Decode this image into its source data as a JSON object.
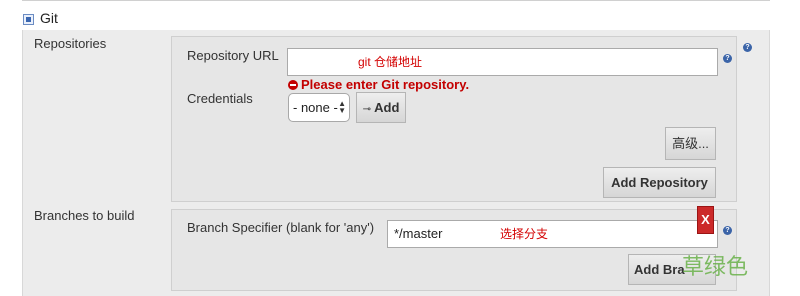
{
  "scm": {
    "label": "Git",
    "repositories_label": "Repositories",
    "branches_label": "Branches to build"
  },
  "repository": {
    "url_label": "Repository URL",
    "url_value": "",
    "url_hint": "git 仓储地址",
    "error": "Please enter Git repository.",
    "credentials_label": "Credentials",
    "credentials_selected": "- none -",
    "add_credentials_label": "Add",
    "advanced_label": "高级...",
    "add_repository_label": "Add Repository"
  },
  "branch": {
    "specifier_label": "Branch Specifier (blank for 'any')",
    "specifier_value": "*/master",
    "specifier_hint": "选择分支",
    "delete_label": "X",
    "add_branch_label": "Add Bra"
  },
  "help": {
    "glyph": "?"
  },
  "watermark": "草绿色",
  "colors": {
    "error_red": "#c30000",
    "help_blue": "#3b64a8",
    "delete_red": "#cc2a2a",
    "watermark_green": "#6ab24a"
  }
}
